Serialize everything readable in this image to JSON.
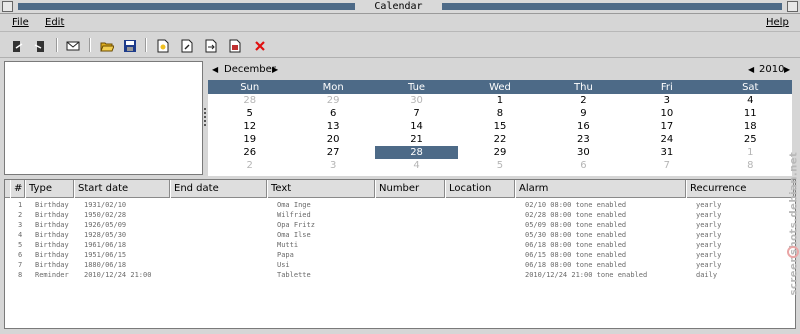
{
  "window": {
    "title": "Calendar"
  },
  "menu": {
    "file": "File",
    "edit": "Edit",
    "help": "Help"
  },
  "toolbar": {
    "icons": [
      "export-icon",
      "import-icon",
      "mail-icon",
      "open-folder-icon",
      "save-icon",
      "new-birthday-icon",
      "edit-entry-icon",
      "move-entry-icon",
      "print-icon",
      "delete-icon"
    ],
    "colors": {
      "accent": "#4d6a87",
      "delete": "#e01010"
    }
  },
  "calendar": {
    "month": "December",
    "year": "2010",
    "weekdays": [
      "Sun",
      "Mon",
      "Tue",
      "Wed",
      "Thu",
      "Fri",
      "Sat"
    ],
    "weeks": [
      [
        {
          "d": "28",
          "o": true
        },
        {
          "d": "29",
          "o": true
        },
        {
          "d": "30",
          "o": true
        },
        {
          "d": "1"
        },
        {
          "d": "2"
        },
        {
          "d": "3"
        },
        {
          "d": "4"
        }
      ],
      [
        {
          "d": "5"
        },
        {
          "d": "6"
        },
        {
          "d": "7"
        },
        {
          "d": "8"
        },
        {
          "d": "9"
        },
        {
          "d": "10"
        },
        {
          "d": "11"
        }
      ],
      [
        {
          "d": "12"
        },
        {
          "d": "13"
        },
        {
          "d": "14"
        },
        {
          "d": "15"
        },
        {
          "d": "16"
        },
        {
          "d": "17"
        },
        {
          "d": "18"
        }
      ],
      [
        {
          "d": "19"
        },
        {
          "d": "20"
        },
        {
          "d": "21"
        },
        {
          "d": "22"
        },
        {
          "d": "23"
        },
        {
          "d": "24"
        },
        {
          "d": "25"
        }
      ],
      [
        {
          "d": "26"
        },
        {
          "d": "27"
        },
        {
          "d": "28",
          "sel": true
        },
        {
          "d": "29"
        },
        {
          "d": "30"
        },
        {
          "d": "31"
        },
        {
          "d": "1",
          "o": true
        }
      ],
      [
        {
          "d": "2",
          "o": true
        },
        {
          "d": "3",
          "o": true
        },
        {
          "d": "4",
          "o": true
        },
        {
          "d": "5",
          "o": true
        },
        {
          "d": "6",
          "o": true
        },
        {
          "d": "7",
          "o": true
        },
        {
          "d": "8",
          "o": true
        }
      ]
    ]
  },
  "list": {
    "columns": [
      "#",
      "Type",
      "Start date",
      "End date",
      "Text",
      "Number",
      "Location",
      "Alarm",
      "Recurrence"
    ],
    "rows": [
      [
        "1",
        "Birthday",
        "1931/02/10",
        "",
        "Oma Inge",
        "",
        "",
        "02/10 08:00 tone enabled",
        "yearly"
      ],
      [
        "2",
        "Birthday",
        "1950/02/28",
        "",
        "Wilfried",
        "",
        "",
        "02/28 08:00 tone enabled",
        "yearly"
      ],
      [
        "3",
        "Birthday",
        "1926/05/09",
        "",
        "Opa Fritz",
        "",
        "",
        "05/09 08:00 tone enabled",
        "yearly"
      ],
      [
        "4",
        "Birthday",
        "1928/05/30",
        "",
        "Oma Ilse",
        "",
        "",
        "05/30 08:00 tone enabled",
        "yearly"
      ],
      [
        "5",
        "Birthday",
        "1961/06/18",
        "",
        "Mutti",
        "",
        "",
        "06/18 08:00 tone enabled",
        "yearly"
      ],
      [
        "6",
        "Birthday",
        "1951/06/15",
        "",
        "Papa",
        "",
        "",
        "06/15 08:00 tone enabled",
        "yearly"
      ],
      [
        "7",
        "Birthday",
        "1880/06/18",
        "",
        "Usi",
        "",
        "",
        "06/18 08:00 tone enabled",
        "yearly"
      ],
      [
        "8",
        "Reminder",
        "2010/12/24 21:00",
        "",
        "Tablette",
        "",
        "",
        "2010/12/24 21:00 tone enabled",
        "daily"
      ]
    ]
  },
  "watermark": "screenshots.debian.net"
}
